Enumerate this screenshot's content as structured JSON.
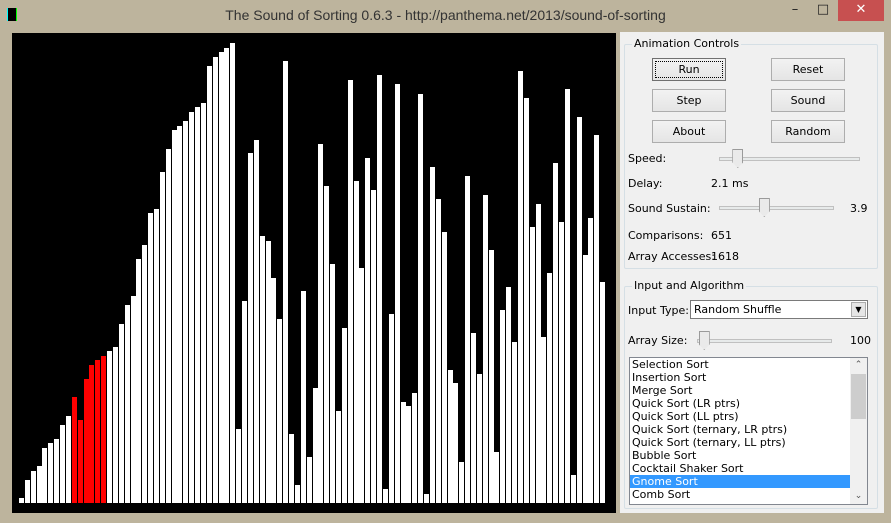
{
  "window": {
    "title": "The Sound of Sorting 0.6.3 - http://panthema.net/2013/sound-of-sorting",
    "minimize_icon": "minimize-icon",
    "maximize_icon": "maximize-icon",
    "close_icon": "close-icon",
    "close_color": "#c75050"
  },
  "chart_data": {
    "type": "bar",
    "values": [
      1,
      5,
      7,
      8,
      12,
      13,
      14,
      17,
      19,
      23,
      18,
      27,
      30,
      31,
      32,
      33,
      34,
      39,
      43,
      45,
      53,
      56,
      63,
      64,
      72,
      77,
      81,
      82,
      83,
      85,
      86,
      87,
      95,
      97,
      98,
      99,
      100,
      16,
      44,
      76,
      79,
      58,
      57,
      49,
      40,
      96,
      15,
      4,
      46,
      10,
      25,
      78,
      69,
      52,
      20,
      38,
      92,
      70,
      51,
      75,
      68,
      93,
      3,
      41,
      91,
      22,
      21,
      24,
      89,
      2,
      73,
      66,
      59,
      29,
      26,
      9,
      71,
      37,
      28,
      67,
      55,
      11,
      42,
      47,
      35,
      94,
      88,
      60,
      65,
      36,
      50,
      74,
      61,
      90,
      6,
      84,
      54,
      62,
      80,
      48
    ],
    "highlighted_indices": [
      9,
      10,
      11,
      12,
      13,
      14
    ],
    "bar_color": "#ffffff",
    "highlight_color": "#ff0000",
    "background": "#000000",
    "ylim": [
      0,
      100
    ]
  },
  "animation": {
    "title": "Animation Controls",
    "buttons": {
      "run": "Run",
      "reset": "Reset",
      "step": "Step",
      "sound": "Sound",
      "about": "About",
      "random": "Random"
    },
    "speed_label": "Speed:",
    "speed_value": 0.13,
    "delay_label": "Delay:",
    "delay_value": "2.1 ms",
    "sustain_label": "Sound Sustain:",
    "sustain_value": "3.9",
    "sustain_fraction": 0.39,
    "comparisons_label": "Comparisons:",
    "comparisons_value": "651",
    "accesses_label": "Array Accesses:",
    "accesses_value": "1618"
  },
  "input": {
    "title": "Input and Algorithm",
    "input_type_label": "Input Type:",
    "input_type_value": "Random Shuffle",
    "array_size_label": "Array Size:",
    "array_size_value": "100",
    "array_size_fraction": 0.05,
    "algorithms": [
      "Selection Sort",
      "Insertion Sort",
      "Merge Sort",
      "Quick Sort (LR ptrs)",
      "Quick Sort (LL ptrs)",
      "Quick Sort (ternary, LR ptrs)",
      "Quick Sort (ternary, LL ptrs)",
      "Bubble Sort",
      "Cocktail Shaker Sort",
      "Gnome Sort",
      "Comb Sort"
    ],
    "selected_algorithm": "Gnome Sort",
    "selection_color": "#3399ff"
  }
}
